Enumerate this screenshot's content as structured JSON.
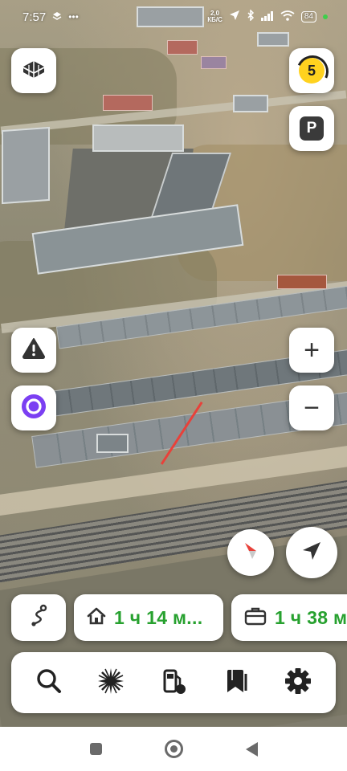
{
  "status_bar": {
    "time": "7:57",
    "network_speed_value": "2,0",
    "network_speed_unit": "КБ/С",
    "battery": "84"
  },
  "map_controls": {
    "speed_limit": "5",
    "parking_label": "P",
    "zoom_in_label": "+",
    "zoom_out_label": "−"
  },
  "routes": [
    {
      "icon": "home-icon",
      "time": "1 ч 14 м..."
    },
    {
      "icon": "briefcase-icon",
      "time": "1 ч 38 м"
    }
  ],
  "toolbar": {
    "items": [
      "search-icon",
      "spark-icon",
      "gas-station-icon",
      "bookmarks-icon",
      "gear-icon"
    ]
  },
  "colors": {
    "route_time_green": "#27a12f",
    "alice_purple": "#7b3ff2",
    "compass_red": "#e8413a",
    "speed_yellow": "#ffd21f",
    "route_line_red": "#e8413a"
  }
}
